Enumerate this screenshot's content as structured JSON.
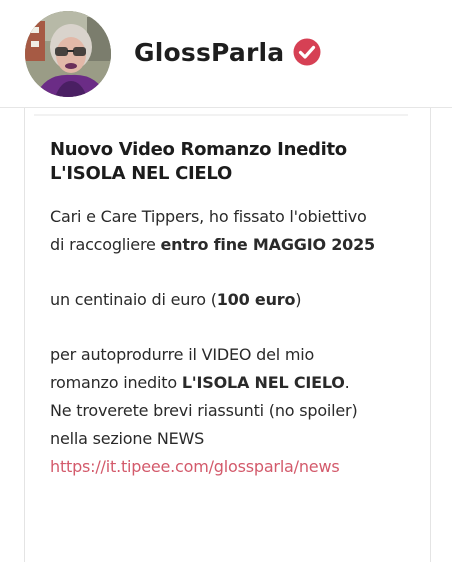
{
  "header": {
    "name": "GlossParla",
    "verified_icon": "verified-check-icon",
    "verified_color": "#d64054"
  },
  "post": {
    "title_line1": "Nuovo Video Romanzo Inedito",
    "title_line2": "L'ISOLA NEL CIELO",
    "p1_a": "Cari e Care Tippers, ho fissato l'obiettivo",
    "p1_b": "di raccogliere ",
    "p1_bold": "entro fine MAGGIO 2025",
    "p2_a": "un centinaio di euro  (",
    "p2_bold": "100 euro",
    "p2_b": ")",
    "p3_a": "per autoprodurre il VIDEO del mio",
    "p3_b": "romanzo inedito  ",
    "p3_bold": "L'ISOLA NEL CIELO",
    "p3_c": ".",
    "p3_d": "Ne troverete brevi riassunti (no spoiler)",
    "p3_e": "nella sezione NEWS",
    "link": "https://it.tipeee.com/glossparla/news",
    "link_color": "#d35a6b"
  }
}
